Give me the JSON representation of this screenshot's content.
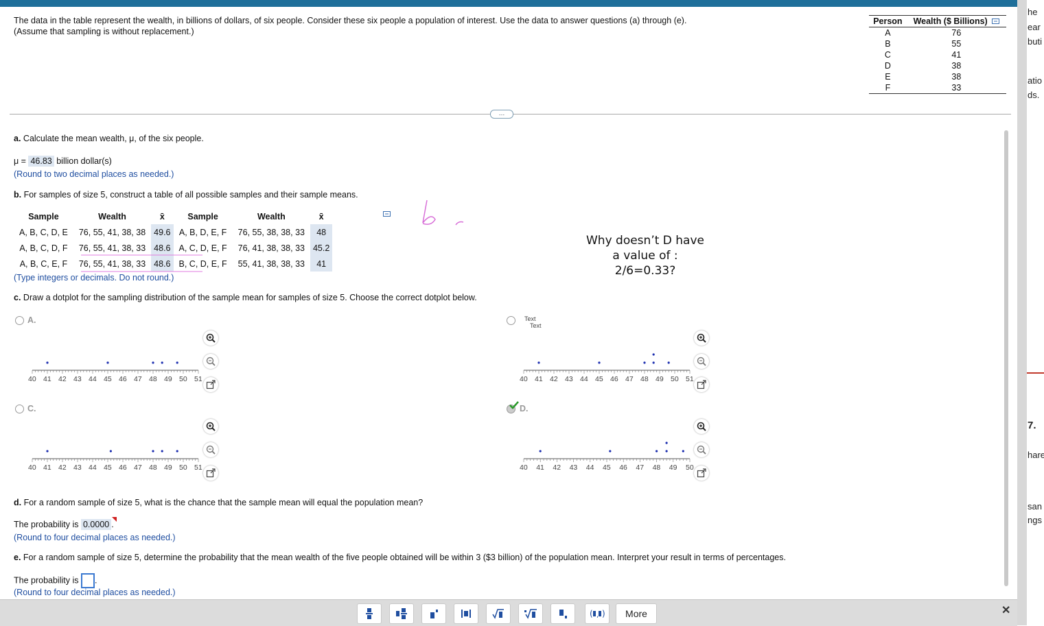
{
  "intro": {
    "line1": "The data in the table represent the wealth, in billions of dollars, of six people. Consider these six people a population of interest. Use the data to answer questions (a) through (e).",
    "line2": "(Assume that sampling is without replacement.)"
  },
  "wealth_table": {
    "headers": [
      "Person",
      "Wealth ($ Billions)"
    ],
    "rows": [
      [
        "A",
        "76"
      ],
      [
        "B",
        "55"
      ],
      [
        "C",
        "41"
      ],
      [
        "D",
        "38"
      ],
      [
        "E",
        "38"
      ],
      [
        "F",
        "33"
      ]
    ]
  },
  "expand_button": "…",
  "part_a": {
    "label": "a.",
    "question": "Calculate the mean wealth, μ, of the six people.",
    "answer_prefix": "μ =",
    "answer_value": "46.83",
    "answer_unit": "billion dollar(s)",
    "hint": "(Round to two decimal places as needed.)"
  },
  "part_b": {
    "label": "b.",
    "question": "For samples of size 5, construct a table of all possible samples and their sample means.",
    "headers": [
      "Sample",
      "Wealth",
      "x̄",
      "Sample",
      "Wealth",
      "x̄"
    ],
    "rows": [
      [
        "A, B, C, D, E",
        "76, 55, 41, 38, 38",
        "49.6",
        "A, B, D, E, F",
        "76, 55, 38, 38, 33",
        "48"
      ],
      [
        "A, B, C, D, F",
        "76, 55, 41, 38, 33",
        "48.6",
        "A, C, D, E, F",
        "76, 41, 38, 38, 33",
        "45.2"
      ],
      [
        "A, B, C, E, F",
        "76, 55, 41, 38, 33",
        "48.6",
        "B, C, D, E, F",
        "55, 41, 38, 38, 33",
        "41"
      ]
    ],
    "hint": "(Type integers or decimals. Do not round.)"
  },
  "handwritten_note": [
    "Why doesn’t D have",
    "a value of :",
    "2/6=0.33?"
  ],
  "part_c": {
    "label": "c.",
    "question": "Draw a dotplot for the sampling distribution of the sample mean for samples of size 5. Choose the correct dotplot below.",
    "options": [
      {
        "label": "A.",
        "ticks": [
          "40",
          "41",
          "42",
          "43",
          "44",
          "45",
          "46",
          "47",
          "48",
          "49",
          "50",
          "51"
        ],
        "dots": [
          [
            41,
            1
          ],
          [
            45,
            1
          ],
          [
            48,
            1
          ],
          [
            48.6,
            1
          ],
          [
            49.6,
            1
          ]
        ],
        "min": 40,
        "max": 51
      },
      {
        "label": "B.",
        "ticks": [
          "40",
          "41",
          "42",
          "43",
          "44",
          "45",
          "46",
          "47",
          "48",
          "49",
          "50",
          "51"
        ],
        "dots": [
          [
            41,
            1
          ],
          [
            45,
            1
          ],
          [
            48,
            1
          ],
          [
            48.6,
            1
          ],
          [
            48.6,
            2
          ],
          [
            49.6,
            1
          ]
        ],
        "min": 40,
        "max": 51,
        "overlay_text": [
          "Text",
          "Text"
        ]
      },
      {
        "label": "C.",
        "ticks": [
          "40",
          "41",
          "42",
          "43",
          "44",
          "45",
          "46",
          "47",
          "48",
          "49",
          "50",
          "51"
        ],
        "dots": [
          [
            41,
            1
          ],
          [
            45.2,
            1
          ],
          [
            48,
            1
          ],
          [
            48.6,
            1
          ],
          [
            49.6,
            1
          ]
        ],
        "min": 40,
        "max": 51
      },
      {
        "label": "D.",
        "ticks": [
          "40",
          "41",
          "42",
          "43",
          "44",
          "45",
          "46",
          "47",
          "48",
          "49",
          "50"
        ],
        "dots": [
          [
            41,
            1
          ],
          [
            45.2,
            1
          ],
          [
            48,
            1
          ],
          [
            48.6,
            1
          ],
          [
            48.6,
            2
          ],
          [
            49.6,
            1
          ]
        ],
        "min": 40,
        "max": 50,
        "selected": true,
        "correct": true
      }
    ]
  },
  "part_d": {
    "label": "d.",
    "question": "For a random sample of size 5, what is the chance that the sample mean will equal the population mean?",
    "answer_prefix": "The probability is",
    "answer_value": "0.0000",
    "hint": "(Round to four decimal places as needed.)"
  },
  "part_e": {
    "label": "e.",
    "question": "For a random sample of size 5, determine the probability that the mean wealth of the five people obtained will be within 3 ($3 billion) of the population mean. Interpret your result in terms of percentages.",
    "answer_prefix": "The probability is",
    "hint": "(Round to four decimal places as needed.)"
  },
  "toolbar": {
    "tools": [
      "fraction",
      "mixed-number",
      "exponent",
      "absolute-value",
      "sqrt",
      "nth-root",
      "subscript",
      "ordered-pair"
    ],
    "more_label": "More"
  },
  "right_fragments": [
    "he",
    "ear",
    "buti",
    "atio",
    "ds.",
    "7.",
    "hare",
    "san",
    "ngs"
  ]
}
